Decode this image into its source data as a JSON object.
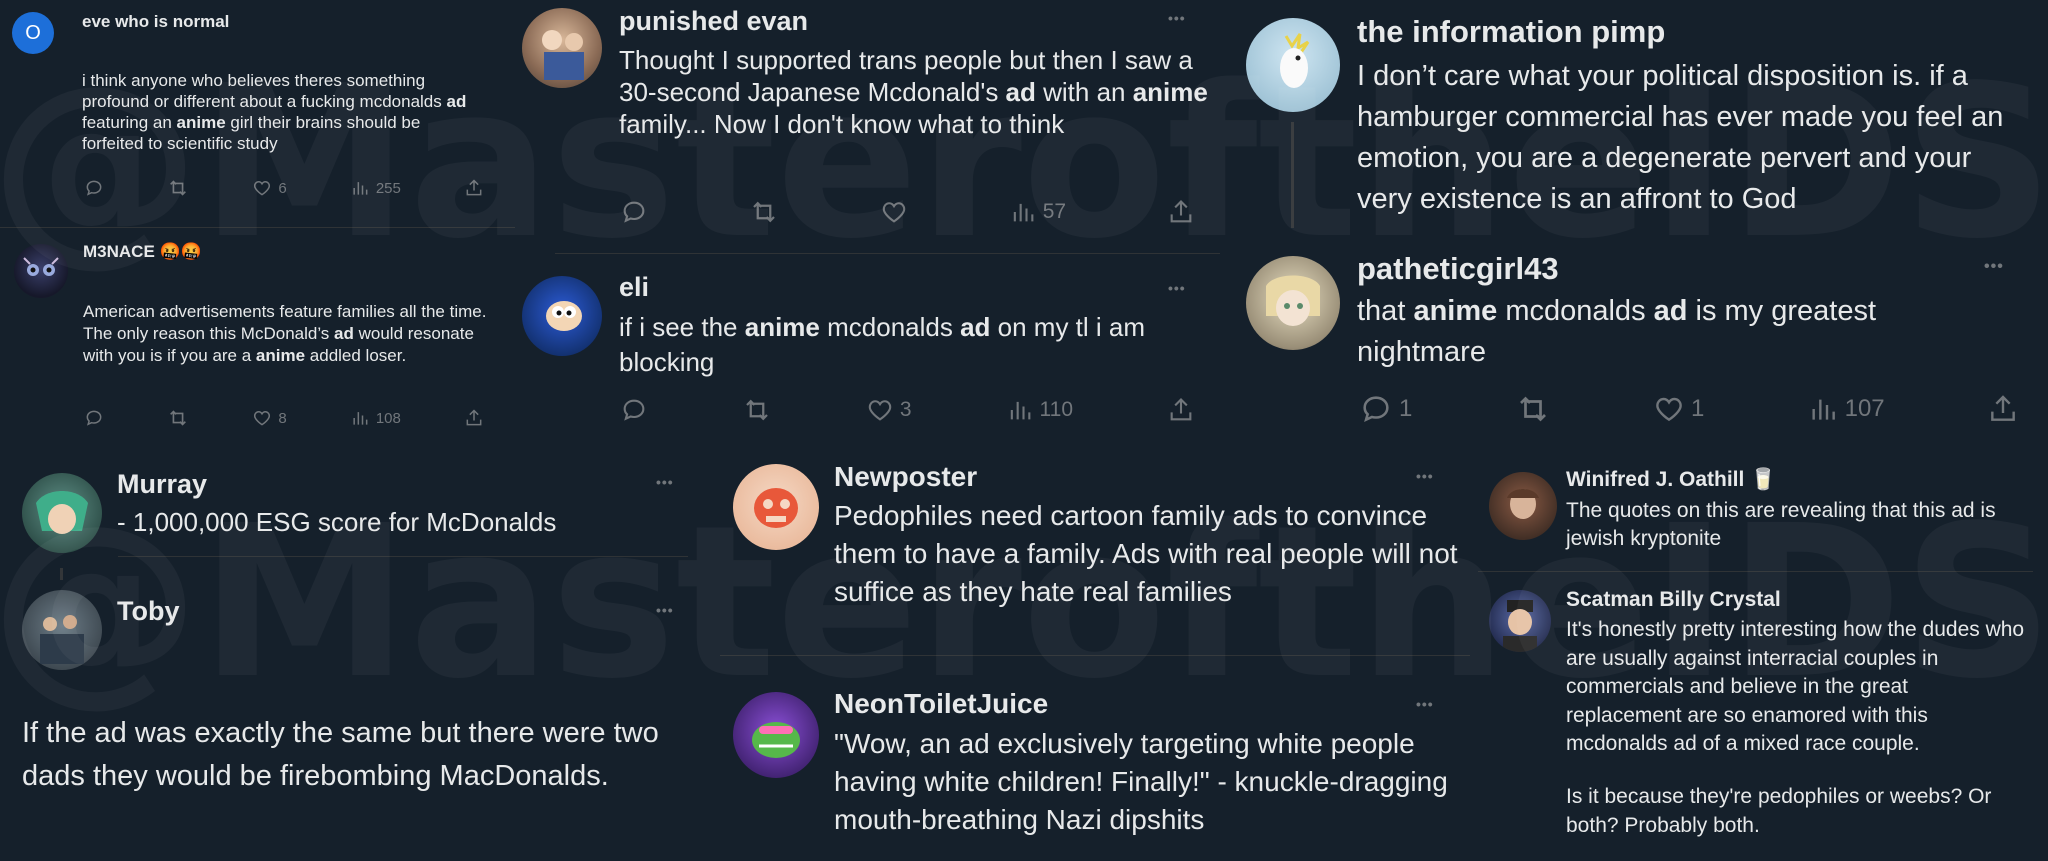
{
  "watermark": "@MasteroftheIDS",
  "colors": {
    "background": "#15202b",
    "text": "#e7e9ea",
    "muted": "#71767b"
  },
  "tweets": {
    "eve": {
      "avatar_letter": "O",
      "name": "eve who is normal",
      "body": [
        "i think anyone who believes theres something profound or different about a fucking mcdonalds ",
        "ad",
        " featuring an ",
        "anime",
        " girl their brains should be forfeited to scientific study"
      ],
      "likes": "6",
      "views": "255"
    },
    "m3nace": {
      "name": "M3NACE 🤬🤬",
      "body": [
        "American advertisements feature families all the time. The only reason this McDonald’s ",
        "ad",
        " would resonate with you is if you are a ",
        "anime",
        " addled loser."
      ],
      "likes": "8",
      "views": "108"
    },
    "evan": {
      "name": "punished evan",
      "more": "•••",
      "body": [
        "Thought I supported trans people but then I saw a 30-second Japanese Mcdonald's ",
        "ad",
        " with an ",
        "anime",
        " family... Now I don't know what to think"
      ],
      "views": "57"
    },
    "eli": {
      "name": "eli",
      "more": "•••",
      "body": [
        "if i see the ",
        "anime",
        " mcdonalds ",
        "ad",
        " on my tl i am blocking"
      ],
      "likes": "3",
      "views": "110"
    },
    "pimp": {
      "name": "the information pimp",
      "body": "I don’t care what your political disposition is. if a hamburger commercial has ever made you feel an emotion, you are a degenerate pervert and your very existence is an affront to God"
    },
    "pathetic": {
      "name": "patheticgirl43",
      "more": "•••",
      "body": [
        "that ",
        "anime",
        " mcdonalds ",
        "ad",
        " is my greatest nightmare"
      ],
      "replies": "1",
      "likes": "1",
      "views": "107"
    },
    "murray": {
      "name": "Murray",
      "more": "•••",
      "body": "- 1,000,000 ESG score for McDonalds"
    },
    "toby": {
      "name": "Toby",
      "more": "•••",
      "body": "If the ad was exactly the same but there were two dads they would be firebombing MacDonalds."
    },
    "newposter": {
      "name": "Newposter",
      "more": "•••",
      "body": "Pedophiles need cartoon family ads to convince them to have a family. Ads with real people will not suffice as they hate real families"
    },
    "neon": {
      "name": "NeonToiletJuice",
      "more": "•••",
      "body": "\"Wow, an ad exclusively targeting white people having white children! Finally!\" - knuckle-dragging mouth-breathing Nazi dipshits"
    },
    "winifred": {
      "name": "Winifred J. Oathill 🥛",
      "body": "The quotes on this are revealing that this ad is jewish kryptonite"
    },
    "scatman": {
      "name": "Scatman Billy Crystal",
      "body": "It's honestly pretty interesting how the dudes who are usually against interracial couples in commercials and believe in the great replacement are so enamored with this mcdonalds ad of a mixed race couple.",
      "body2": "Is it because they're pedophiles or weebs? Or both? Probably both."
    }
  }
}
